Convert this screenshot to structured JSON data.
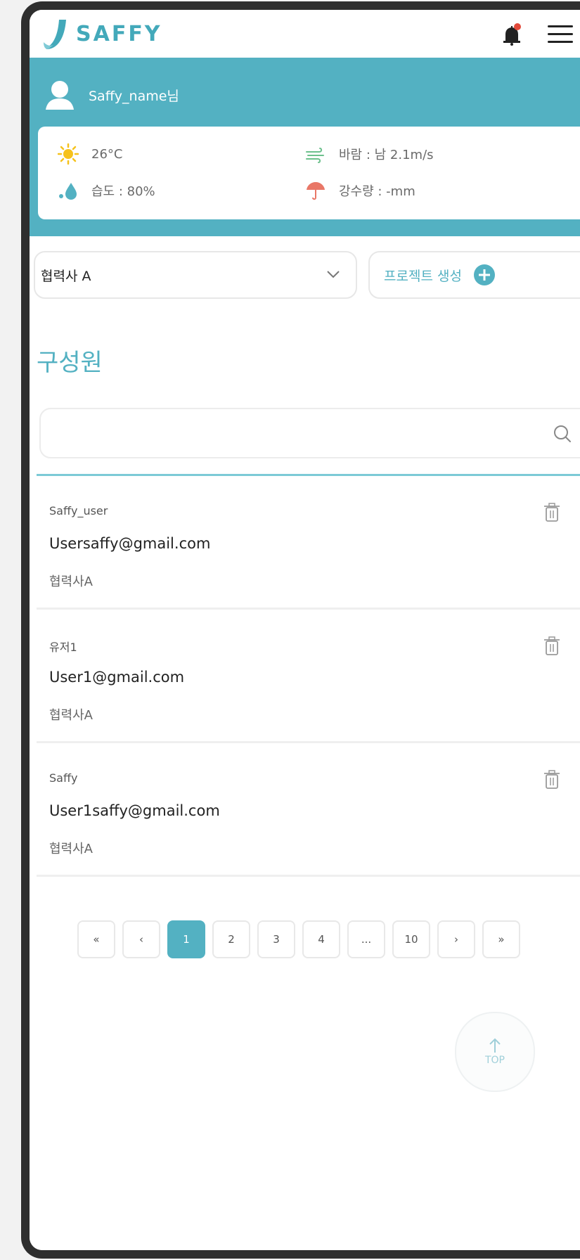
{
  "header": {
    "logo_text": "SAFFY"
  },
  "user": {
    "name": "Saffy_name님"
  },
  "weather": {
    "temperature": "26°C",
    "wind": "바람 : 남 2.1m/s",
    "humidity": "습도 : 80%",
    "rain": "강수량 : -mm"
  },
  "controls": {
    "partner_selected": "협력사 A",
    "create_project_label": "프로젝트 생성"
  },
  "section": {
    "title": "구성원"
  },
  "search": {
    "value": "",
    "placeholder": ""
  },
  "members": [
    {
      "name": "Saffy_user",
      "email": "Usersaffy@gmail.com",
      "company": "협력사A"
    },
    {
      "name": "유저1",
      "email": "User1@gmail.com",
      "company": "협력사A"
    },
    {
      "name": "Saffy",
      "email": "User1saffy@gmail.com",
      "company": "협력사A"
    }
  ],
  "pagination": {
    "first": "«",
    "prev": "‹",
    "pages": [
      "1",
      "2",
      "3",
      "4",
      "...",
      "10"
    ],
    "current": "1",
    "next": "›",
    "last": "»"
  },
  "top_button": {
    "label": "TOP"
  },
  "colors": {
    "accent": "#53b1c2",
    "logo": "#43a9ba"
  }
}
